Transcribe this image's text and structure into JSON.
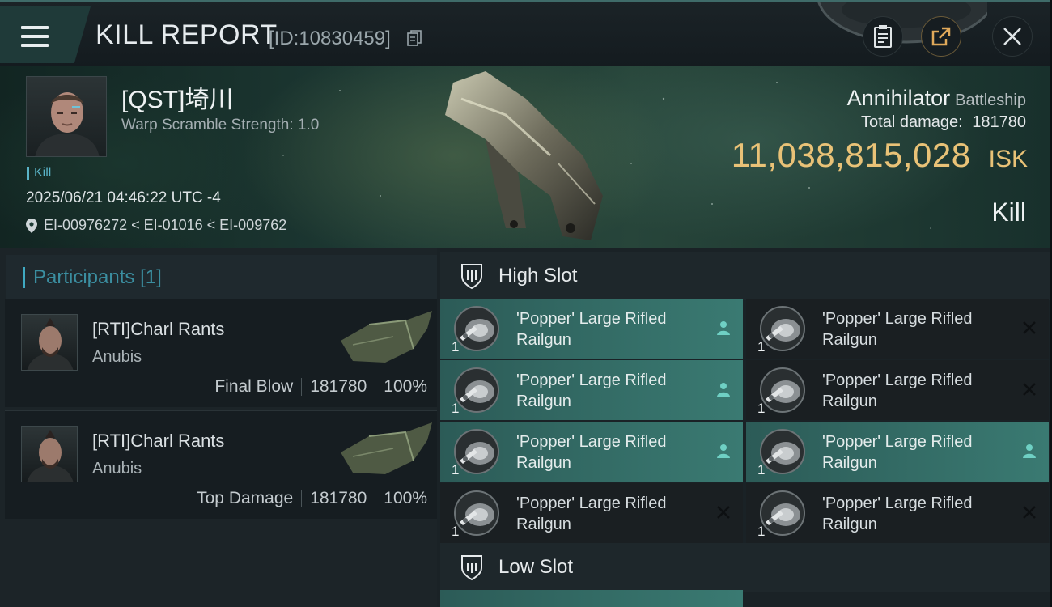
{
  "header": {
    "title": "KILL REPORT",
    "kill_id": "[ID:10830459]",
    "buttons": [
      "clipboard-icon",
      "share-icon",
      "close-icon"
    ]
  },
  "victim": {
    "name": "[QST]埼川",
    "warp_scramble": "Warp Scramble Strength: 1.0",
    "tag": "Kill",
    "datetime": "2025/06/21 04:46:22 UTC -4",
    "location": "EI-00976272 < EI-01016 < EI-009762",
    "ship_name": "Annihilator",
    "ship_class": "Battleship",
    "total_damage_label": "Total damage:",
    "total_damage": "181780",
    "isk_value": "11,038,815,028",
    "isk_unit": "ISK",
    "result": "Kill"
  },
  "participants": {
    "label": "Participants",
    "count": "[1]",
    "rows": [
      {
        "name": "[RTI]Charl Rants",
        "ship": "Anubis",
        "role": "Final Blow",
        "damage": "181780",
        "percent": "100%"
      },
      {
        "name": "[RTI]Charl Rants",
        "ship": "Anubis",
        "role": "Top Damage",
        "damage": "181780",
        "percent": "100%"
      }
    ]
  },
  "fitting": {
    "high_slot_label": "High Slot",
    "low_slot_label": "Low Slot",
    "modules": [
      {
        "name_line1": "'Popper' Large Rifled",
        "name_line2": "Railgun",
        "qty": "1",
        "state": "fitted"
      },
      {
        "name_line1": "'Popper' Large Rifled",
        "name_line2": "Railgun",
        "qty": "1",
        "state": "destroyed"
      },
      {
        "name_line1": "'Popper' Large Rifled",
        "name_line2": "Railgun",
        "qty": "1",
        "state": "fitted"
      },
      {
        "name_line1": "'Popper' Large Rifled",
        "name_line2": "Railgun",
        "qty": "1",
        "state": "destroyed"
      },
      {
        "name_line1": "'Popper' Large Rifled",
        "name_line2": "Railgun",
        "qty": "1",
        "state": "fitted"
      },
      {
        "name_line1": "'Popper' Large Rifled",
        "name_line2": "Railgun",
        "qty": "1",
        "state": "fitted"
      },
      {
        "name_line1": "'Popper' Large Rifled",
        "name_line2": "Railgun",
        "qty": "1",
        "state": "destroyed"
      },
      {
        "name_line1": "'Popper' Large Rifled",
        "name_line2": "Railgun",
        "qty": "1",
        "state": "destroyed"
      }
    ]
  },
  "colors": {
    "accent_teal": "#3fa9c1",
    "isk_gold": "#e9c277",
    "fitted_bg": "#3a7a72"
  }
}
